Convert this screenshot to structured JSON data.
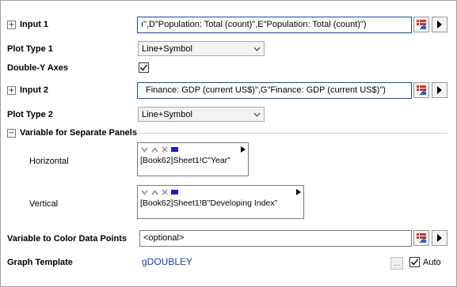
{
  "input1": {
    "label": "Input 1",
    "value": "ı\",D\"Population: Total (count)\",E\"Population: Total (count)\")"
  },
  "plot_type1": {
    "label": "Plot Type 1",
    "value": "Line+Symbol"
  },
  "double_y": {
    "label": "Double-Y Axes",
    "checked": true
  },
  "input2": {
    "label": "Input 2",
    "value": "Finance: GDP (current US$)\",G\"Finance: GDP (current US$)\")"
  },
  "plot_type2": {
    "label": "Plot Type 2",
    "value": "Line+Symbol"
  },
  "separate_panels": {
    "label": "Variable for Separate Panels",
    "horizontal": {
      "label": "Horizontal",
      "value": "[Book62]Sheet1!C\"Year\""
    },
    "vertical": {
      "label": "Vertical",
      "value": "[Book62]Sheet1!B\"Developing Index\""
    }
  },
  "color_points": {
    "label": "Variable to Color Data Points",
    "value": "<optional>"
  },
  "graph_template": {
    "label": "Graph Template",
    "value": "gDOUBLEY",
    "ellipsis": "...",
    "auto_label": "Auto",
    "auto_checked": true
  },
  "icons": {
    "expand": "plus-box-icon",
    "collapse": "minus-box-icon",
    "range_select": "range-select-icon",
    "arrow": "right-triangle-icon",
    "panel_down": "chevron-down-icon",
    "panel_up": "chevron-up-icon",
    "panel_remove": "x-icon",
    "panel_color": "blue-square-icon"
  },
  "colors": {
    "accent_border": "#0a4fa3",
    "link_blue": "#1a3fb8",
    "panel_icon_gray": "#8a8aa0"
  }
}
